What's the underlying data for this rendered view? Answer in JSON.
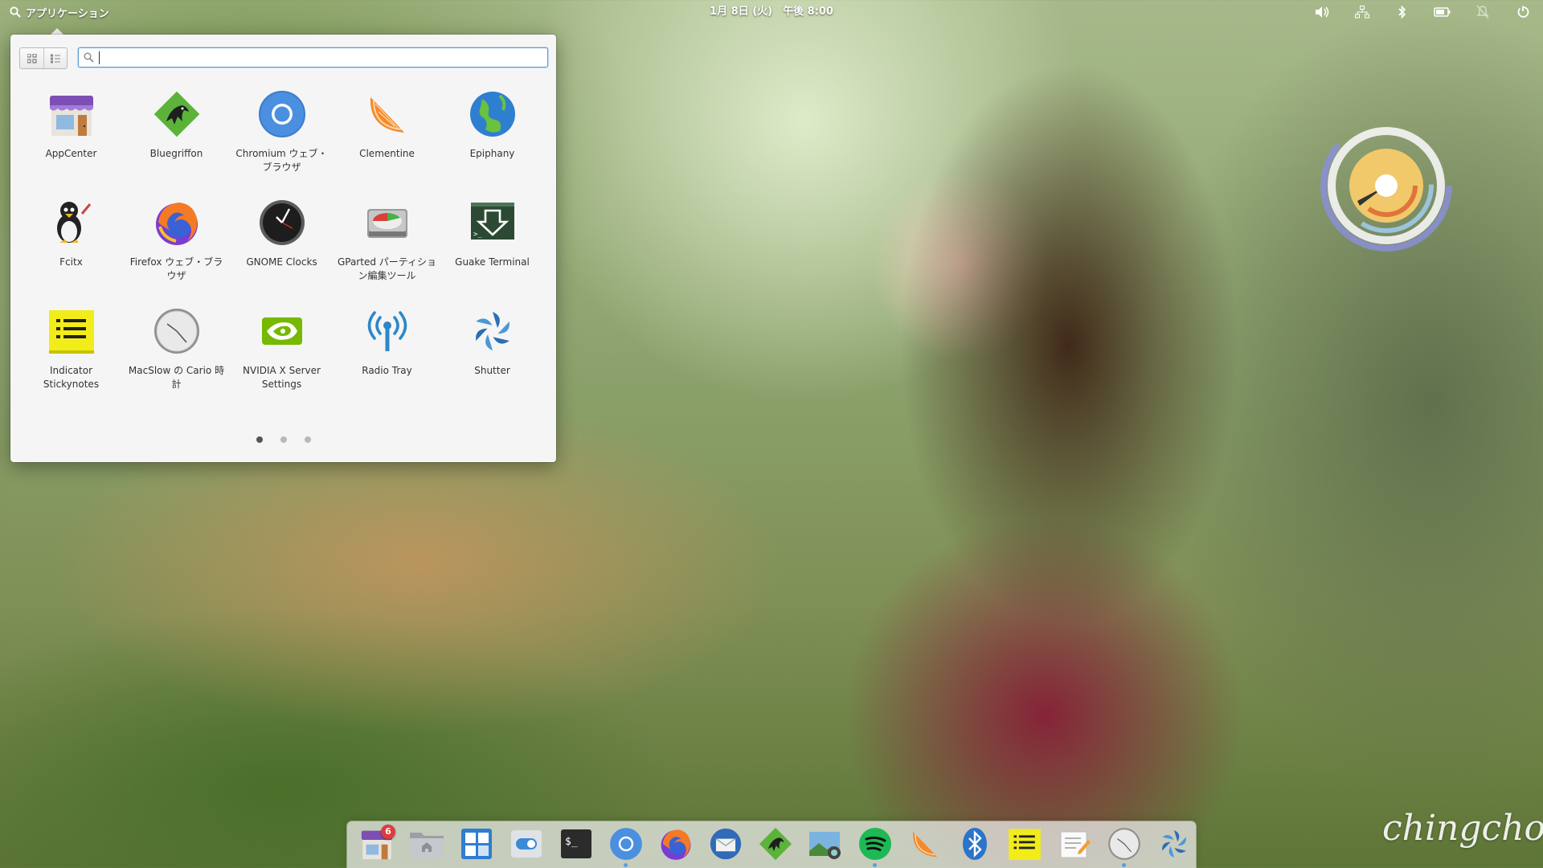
{
  "panel": {
    "applications_label": "アプリケーション",
    "clock": "1月 8日 (火)　午後 8:00",
    "indicators": [
      "volume-icon",
      "network-icon",
      "bluetooth-icon",
      "battery-icon",
      "notifications-off-icon",
      "power-icon"
    ]
  },
  "launcher": {
    "search": {
      "value": "",
      "placeholder": ""
    },
    "apps": [
      {
        "label": "AppCenter",
        "icon": "appcenter-icon"
      },
      {
        "label": "Bluegriffon",
        "icon": "bluegriffon-icon"
      },
      {
        "label": "Chromium ウェブ・ブラウザ",
        "icon": "chromium-icon"
      },
      {
        "label": "Clementine",
        "icon": "clementine-icon"
      },
      {
        "label": "Epiphany",
        "icon": "epiphany-icon"
      },
      {
        "label": "Fcitx",
        "icon": "fcitx-icon"
      },
      {
        "label": "Firefox ウェブ・ブラウザ",
        "icon": "firefox-icon"
      },
      {
        "label": "GNOME Clocks",
        "icon": "gnome-clocks-icon"
      },
      {
        "label": "GParted パーティション編集ツール",
        "icon": "gparted-icon"
      },
      {
        "label": "Guake Terminal",
        "icon": "guake-terminal-icon"
      },
      {
        "label": "Indicator Stickynotes",
        "icon": "stickynotes-icon"
      },
      {
        "label": "MacSlow の Cario 時計",
        "icon": "cairo-clock-icon"
      },
      {
        "label": "NVIDIA X Server Settings",
        "icon": "nvidia-icon"
      },
      {
        "label": "Radio Tray",
        "icon": "radio-tray-icon"
      },
      {
        "label": "Shutter",
        "icon": "shutter-icon"
      }
    ],
    "pages": 3,
    "current_page": 1
  },
  "dock": {
    "items": [
      {
        "name": "appcenter",
        "icon": "appcenter-icon",
        "badge": "6"
      },
      {
        "name": "files",
        "icon": "folder-icon"
      },
      {
        "name": "multitasking-view",
        "icon": "multitasking-icon"
      },
      {
        "name": "system-settings",
        "icon": "switch-icon"
      },
      {
        "name": "terminal",
        "icon": "terminal-icon"
      },
      {
        "name": "chromium",
        "icon": "chromium-icon",
        "running": true
      },
      {
        "name": "firefox",
        "icon": "firefox-icon"
      },
      {
        "name": "thunderbird",
        "icon": "mail-icon"
      },
      {
        "name": "bluegriffon",
        "icon": "bluegriffon-icon"
      },
      {
        "name": "shotwell",
        "icon": "photos-icon"
      },
      {
        "name": "spotify",
        "icon": "spotify-icon",
        "running": true
      },
      {
        "name": "clementine",
        "icon": "clementine-icon"
      },
      {
        "name": "bluetooth",
        "icon": "bluetooth-icon"
      },
      {
        "name": "stickynotes",
        "icon": "stickynotes-icon"
      },
      {
        "name": "text-editor",
        "icon": "text-editor-icon"
      },
      {
        "name": "cairo-clock",
        "icon": "cairo-clock-icon",
        "running": true
      },
      {
        "name": "shutter",
        "icon": "shutter-icon"
      }
    ]
  },
  "watermark": "chingcho",
  "colors": {
    "accent": "#5c9ad6",
    "badge": "#e03b3b"
  }
}
